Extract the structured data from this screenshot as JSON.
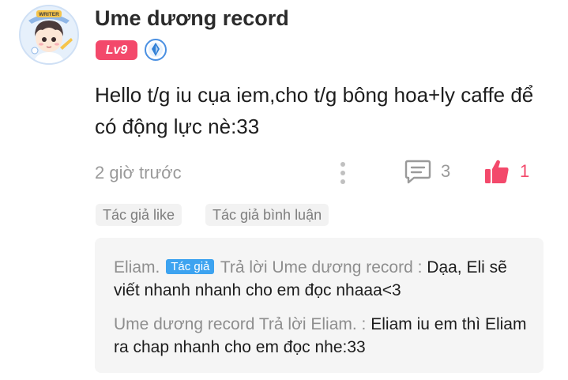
{
  "comment": {
    "username": "Ume dương record",
    "level_badge": "Lv9",
    "avatar_label": "WRITER",
    "text": "Hello t/g iu cụa iem,cho t/g bông hoa+ly caffe để có động lực nè:33",
    "time": "2 giờ trước",
    "reply_count": "3",
    "like_count": "1",
    "tags": [
      "Tác giả like",
      "Tác giả bình luận"
    ]
  },
  "replies": [
    {
      "author": "Eliam.",
      "author_badge": "Tác giả",
      "action": "Trả lời Ume dương record :",
      "text": "Dạa, Eli sẽ viết nhanh nhanh cho em đọc nhaaa<3"
    },
    {
      "author": "Ume dương record",
      "action": "Trả lời Eliam. :",
      "text": "Eliam iu em thì Eliam ra chap nhanh cho em đọc nhe:33"
    }
  ],
  "colors": {
    "accent_pink": "#f3496b",
    "author_badge_blue": "#3da3f0",
    "muted_text": "#9a9a9a"
  },
  "icons": {
    "verified": "verified-shield-icon",
    "more": "more-vertical-icon",
    "reply": "comment-icon",
    "like": "thumbs-up-icon"
  }
}
